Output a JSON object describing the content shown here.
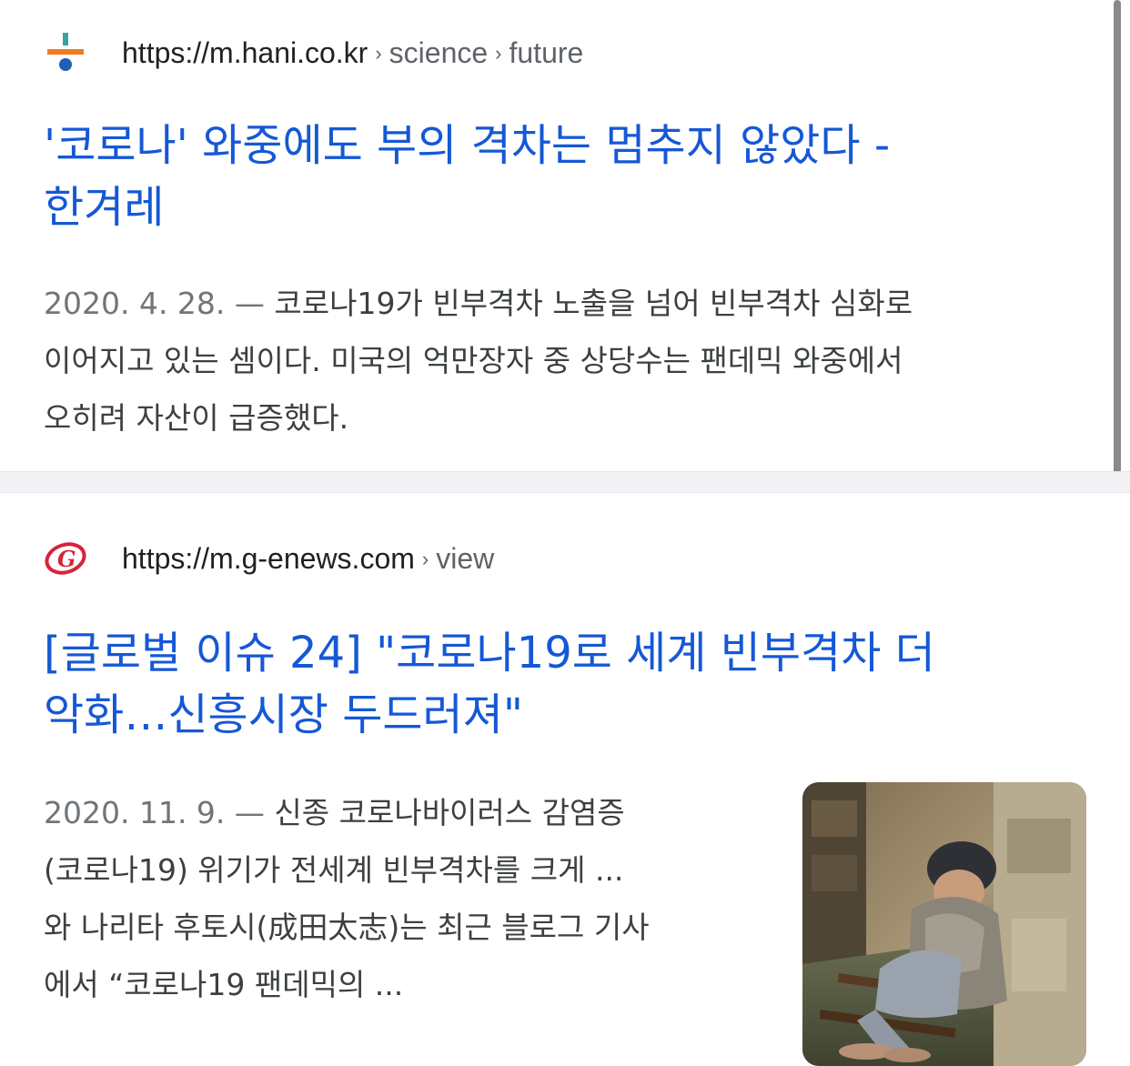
{
  "results": [
    {
      "url_domain": "https://m.hani.co.kr",
      "url_path": [
        "science",
        "future"
      ],
      "breadcrumb_separator": "›",
      "favicon": "hani-logo-icon",
      "title_lines": [
        "'코로나' 와중에도 부의 격차는 멈추지 않았다 -",
        "한겨레"
      ],
      "snippet_date": "2020. 4. 28. —",
      "snippet_lines": [
        " 코로나19가 빈부격차 노출을 넘어 빈부격차 심화로",
        "이어지고 있는 셈이다. 미국의 억만장자 중 상당수는 팬데믹 와중에서",
        "오히려 자산이 급증했다."
      ]
    },
    {
      "url_domain": "https://m.g-enews.com",
      "url_path": [
        "view"
      ],
      "breadcrumb_separator": "›",
      "favicon": "g-enews-logo-icon",
      "title_lines": [
        "[글로벌 이슈 24] \"코로나19로 세계 빈부격차 더",
        "악화…신흥시장 두드러져\""
      ],
      "snippet_date": "2020. 11. 9. —",
      "snippet_lines": [
        " 신종 코로나바이러스 감염증",
        "(코로나19) 위기가 전세계 빈부격차를 크게 ...",
        "와 나리타 후토시(成田太志)는 최근 블로그 기사",
        "에서 “코로나19 팬데믹의 ..."
      ],
      "thumbnail": "homeless-man-photo"
    }
  ],
  "colors": {
    "title": "#1558d6",
    "url": "#202124",
    "breadcrumb": "#5f6368",
    "snippet": "#3c4043",
    "date": "#70757a",
    "divider": "#f1f3f4"
  }
}
